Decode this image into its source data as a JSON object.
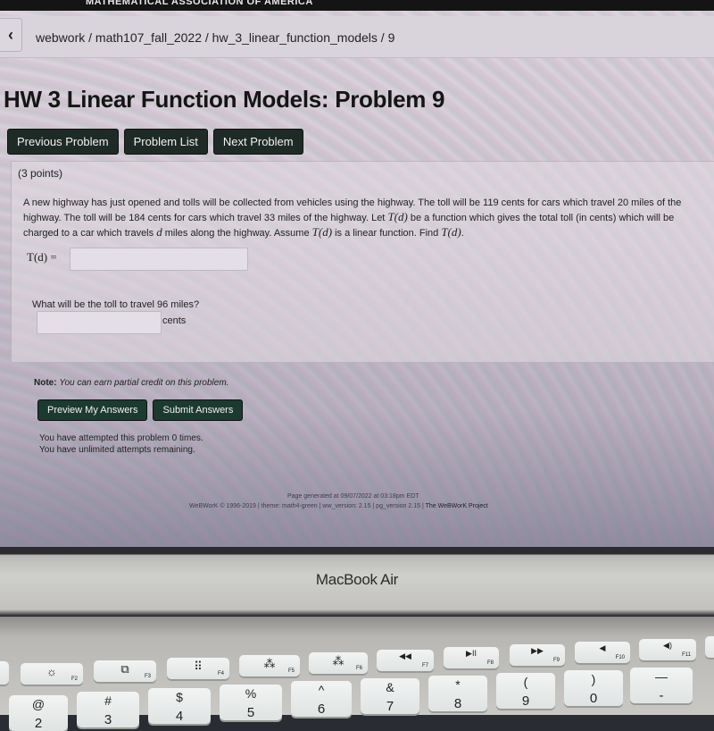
{
  "header": {
    "org_banner": "MATHEMATICAL ASSOCIATION OF AMERICA"
  },
  "nav": {
    "back_icon": "‹",
    "breadcrumb": "webwork / math107_fall_2022 / hw_3_linear_function_models / 9"
  },
  "page": {
    "title": "HW 3 Linear Function Models: Problem 9",
    "buttons": {
      "previous": "Previous Problem",
      "list": "Problem List",
      "next": "Next Problem"
    }
  },
  "problem": {
    "points": "(3 points)",
    "text_parts": [
      "A new highway has just opened and tolls will be collected from vehicles using the highway. The toll will be 119 cents for cars which travel 20 miles of the highway. The toll will be 184 cents for cars which travel 33 miles of the highway. Let ",
      "T(d)",
      " be a function which gives the total toll (in cents) which will be charged to a car which travels ",
      "d",
      " miles along the highway. Assume ",
      "T(d)",
      " is a linear function. Find ",
      "T(d)",
      "."
    ],
    "answer1_label": "T(d) =",
    "answer1_value": "",
    "question2": "What will be the toll to travel 96 miles?",
    "answer2_value": "",
    "answer2_unit": "cents"
  },
  "note": {
    "label": "Note:",
    "text": "You can earn partial credit on this problem."
  },
  "actions": {
    "preview": "Preview My Answers",
    "submit": "Submit Answers"
  },
  "attempts": {
    "line1": "You have attempted this problem 0 times.",
    "line2": "You have unlimited attempts remaining."
  },
  "footer": {
    "generated": "Page generated at 09/07/2022 at 03:18pm EDT",
    "copyright": "WeBWorK © 1996-2019 | theme: math4-green | ww_version: 2.15 | pg_version 2.15 |",
    "project": "The WeBWorK Project"
  },
  "device": {
    "brand": "MacBook Air",
    "keys_fn": [
      {
        "glyph": "☼",
        "label": "F2"
      },
      {
        "glyph": "⧉",
        "label": "F3"
      },
      {
        "glyph": "⠿",
        "label": "F4"
      },
      {
        "glyph": "⁂",
        "label": "F5"
      },
      {
        "glyph": "⁂",
        "label": "F6"
      },
      {
        "glyph": "◀◀",
        "label": "F7"
      },
      {
        "glyph": "▶II",
        "label": "F8"
      },
      {
        "glyph": "▶▶",
        "label": "F9"
      },
      {
        "glyph": "◀",
        "label": "F10"
      },
      {
        "glyph": "◀)",
        "label": "F11"
      }
    ],
    "keys_num": [
      {
        "top": "@",
        "bot": "2"
      },
      {
        "top": "#",
        "bot": "3"
      },
      {
        "top": "$",
        "bot": "4"
      },
      {
        "top": "%",
        "bot": "5"
      },
      {
        "top": "^",
        "bot": "6"
      },
      {
        "top": "&",
        "bot": "7"
      },
      {
        "top": "*",
        "bot": "8"
      },
      {
        "top": "(",
        "bot": "9"
      },
      {
        "top": ")",
        "bot": "0"
      },
      {
        "top": "—",
        "bot": "-"
      }
    ]
  }
}
